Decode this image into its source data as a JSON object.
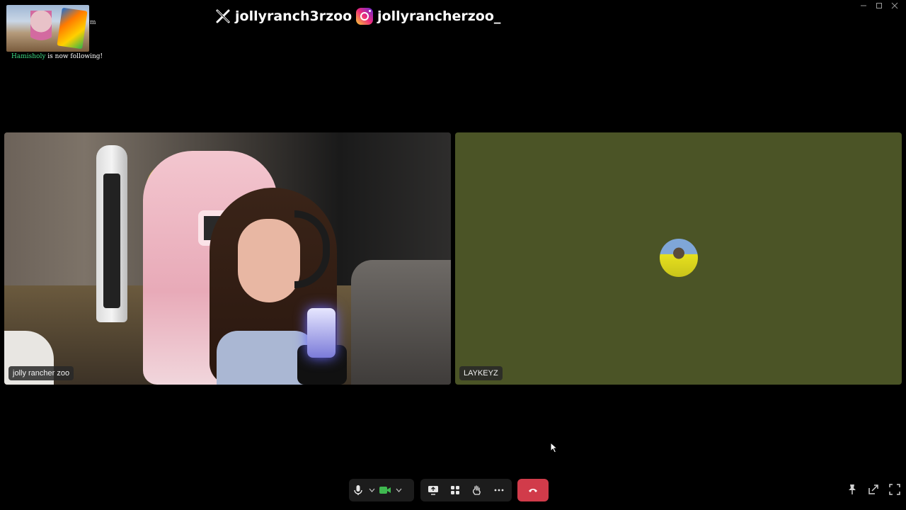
{
  "window": {
    "controls": [
      "minimize-icon",
      "maximize-icon",
      "close-icon"
    ]
  },
  "overlay": {
    "follower_name": "Hamisholy",
    "follow_text": " is now following!",
    "thumb_trailing_text": "m"
  },
  "social": {
    "x_handle": "jollyranch3rzoo",
    "instagram_handle": "jollyrancherzoo_"
  },
  "participants": [
    {
      "name": "jolly rancher zoo",
      "video": "on"
    },
    {
      "name": "LAYKEYZ",
      "video": "off",
      "tile_color": "#4b5426"
    }
  ],
  "toolbar": {
    "buttons": [
      "microphone-icon",
      "chevron-down-icon",
      "camera-icon",
      "chevron-down-icon",
      "screen-share-icon",
      "apps-icon",
      "raise-hand-icon",
      "more-icon"
    ],
    "end_call": "end-call-icon"
  },
  "right_tools": [
    "pin-icon",
    "popout-icon",
    "fullscreen-icon"
  ],
  "colors": {
    "end_call": "#d13b4a",
    "camera_active": "#3fb950",
    "background": "#000000"
  }
}
